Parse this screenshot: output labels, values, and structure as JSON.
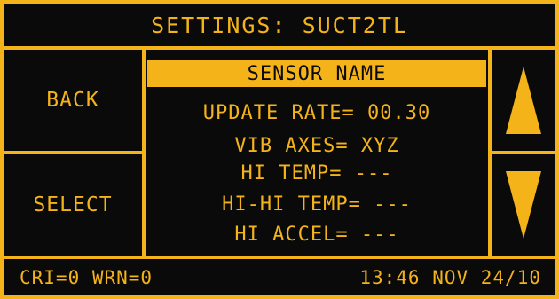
{
  "title": "SETTINGS: SUCT2TL",
  "buttons": {
    "back": "BACK",
    "select": "SELECT"
  },
  "menu": {
    "items": [
      "SENSOR NAME",
      "UPDATE RATE= 00.30",
      "VIB AXES= XYZ",
      "HI TEMP= ---",
      "HI-HI TEMP= ---",
      "HI ACCEL= ---"
    ],
    "selected": "SENSOR NAME"
  },
  "arrows": {
    "up": "arrow-up-icon",
    "down": "arrow-down-icon"
  },
  "status": {
    "counts": "CRI=0 WRN=0",
    "datetime": "13:46 NOV 24/10"
  },
  "colors": {
    "accent": "#f5b31a",
    "background": "#0a0a0a"
  }
}
